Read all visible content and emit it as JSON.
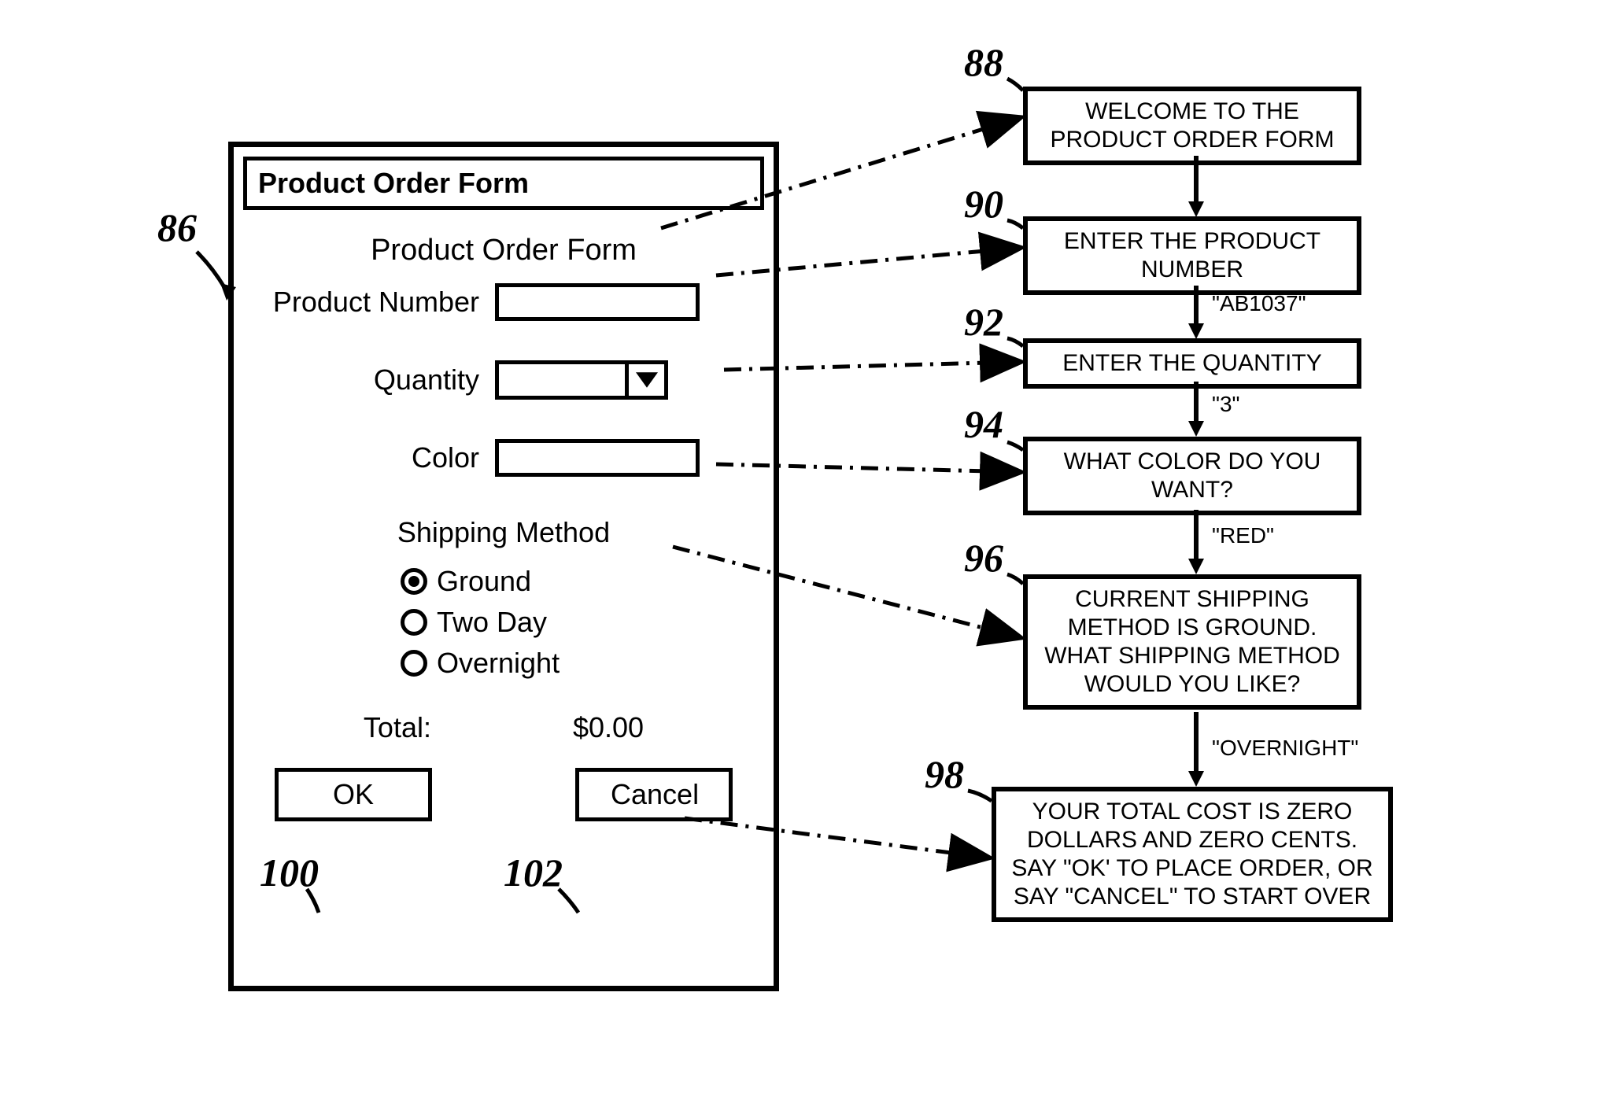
{
  "callouts": {
    "form": "86",
    "step1": "88",
    "step2": "90",
    "step3": "92",
    "step4": "94",
    "step5": "96",
    "step6": "98",
    "ok": "100",
    "cancel": "102"
  },
  "form": {
    "titlebar": "Product Order Form",
    "heading": "Product Order Form",
    "labels": {
      "product_number": "Product Number",
      "quantity": "Quantity",
      "color": "Color",
      "shipping": "Shipping Method",
      "total": "Total:"
    },
    "shipping_options": [
      {
        "label": "Ground",
        "checked": true
      },
      {
        "label": "Two Day",
        "checked": false
      },
      {
        "label": "Overnight",
        "checked": false
      }
    ],
    "total_value": "$0.00",
    "buttons": {
      "ok": "OK",
      "cancel": "Cancel"
    }
  },
  "flow": {
    "step1": "WELCOME TO THE PRODUCT ORDER FORM",
    "step2": "ENTER THE PRODUCT NUMBER",
    "step3": "ENTER THE QUANTITY",
    "step4": "WHAT COLOR DO YOU WANT?",
    "step5": "CURRENT SHIPPING METHOD IS GROUND. WHAT SHIPPING METHOD WOULD YOU LIKE?",
    "step6": "YOUR TOTAL COST IS ZERO DOLLARS AND ZERO CENTS. SAY \"OK' TO PLACE ORDER, OR SAY \"CANCEL\" TO START OVER"
  },
  "arrow_labels": {
    "after_step2": "\"AB1037\"",
    "after_step3": "\"3\"",
    "after_step4": "\"RED\"",
    "after_step5": "\"OVERNIGHT\""
  }
}
